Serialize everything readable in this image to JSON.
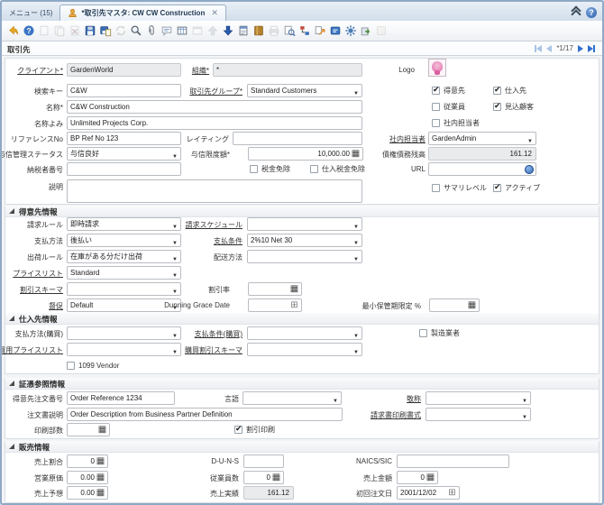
{
  "tabs": {
    "menu": "メニュー (15)",
    "window": "*取引先マスタ: CW CW Construction"
  },
  "window": {
    "title": "取引先",
    "record_position": "*1/17"
  },
  "toolbar": {
    "icons": [
      {
        "name": "undo-icon",
        "enabled": true
      },
      {
        "name": "help-icon",
        "enabled": true
      },
      {
        "name": "new-record-icon",
        "enabled": false
      },
      {
        "name": "copy-record-icon",
        "enabled": false
      },
      {
        "name": "delete-record-icon",
        "enabled": false
      },
      {
        "name": "save-icon",
        "enabled": true
      },
      {
        "name": "save-create-icon",
        "enabled": true
      },
      {
        "name": "refresh-icon",
        "enabled": false
      },
      {
        "name": "find-icon",
        "enabled": true
      },
      {
        "name": "attachment-icon",
        "enabled": true
      },
      {
        "name": "chat-icon",
        "enabled": true
      },
      {
        "name": "grid-toggle-icon",
        "enabled": true
      },
      {
        "name": "preference-icon",
        "enabled": false
      },
      {
        "name": "parent-record-icon",
        "enabled": false
      },
      {
        "name": "detail-record-icon",
        "enabled": true
      },
      {
        "name": "report-icon",
        "enabled": true
      },
      {
        "name": "archive-icon",
        "enabled": true
      },
      {
        "name": "print-icon",
        "enabled": false
      },
      {
        "name": "record-info-icon",
        "enabled": true
      },
      {
        "name": "workflow-icon",
        "enabled": true
      },
      {
        "name": "zoom-across-icon",
        "enabled": true
      },
      {
        "name": "request-icon",
        "enabled": true
      },
      {
        "name": "process-icon",
        "enabled": true
      },
      {
        "name": "export-icon",
        "enabled": true
      },
      {
        "name": "post-icon",
        "enabled": false
      }
    ]
  },
  "sections": {
    "customer": "得意先情報",
    "vendor": "仕入先情報",
    "docref": "証憑参照情報",
    "sales": "販売情報"
  },
  "fields": {
    "client": {
      "label": "クライアント*",
      "value": "GardenWorld"
    },
    "org": {
      "label": "組織*",
      "value": "*"
    },
    "logo": {
      "label": "Logo"
    },
    "search_key": {
      "label": "検索キー",
      "value": "C&W"
    },
    "bp_group": {
      "label": "取引先グループ*",
      "value": "Standard Customers"
    },
    "customer_chk": {
      "label": "得意先",
      "checked": true
    },
    "vendor_chk": {
      "label": "仕入先",
      "checked": true
    },
    "name": {
      "label": "名称*",
      "value": "C&W Construction"
    },
    "employee_chk": {
      "label": "従業員",
      "checked": false
    },
    "prospect_chk": {
      "label": "見込顧客",
      "checked": true
    },
    "name2": {
      "label": "名称よみ",
      "value": "Unlimited Projects Corp."
    },
    "salesrep_chk": {
      "label": "社内担当者",
      "checked": false
    },
    "reference_no": {
      "label": "リファレンスNo",
      "value": "BP Ref No 123"
    },
    "rating": {
      "label": "レイティング",
      "value": ""
    },
    "sales_rep": {
      "label": "社内担当者",
      "value": "GardenAdmin"
    },
    "credit_status": {
      "label": "与信管理ステータス",
      "value": "与信良好"
    },
    "credit_limit": {
      "label": "与信限度額*",
      "value": "10,000.00"
    },
    "open_balance": {
      "label": "債権債務残高",
      "value": "161.12"
    },
    "tax_id": {
      "label": "納税者番号",
      "value": ""
    },
    "tax_exempt_chk": {
      "label": "税金免除",
      "checked": false
    },
    "po_tax_exempt_chk": {
      "label": "仕入税金免除",
      "checked": false
    },
    "url": {
      "label": "URL",
      "value": ""
    },
    "description": {
      "label": "説明",
      "value": ""
    },
    "summary_chk": {
      "label": "サマリレベル",
      "checked": false
    },
    "active_chk": {
      "label": "アクティブ",
      "checked": true
    },
    "invoice_rule": {
      "label": "請求ルール",
      "value": "即時請求"
    },
    "invoice_schedule": {
      "label": "請求スケジュール",
      "value": ""
    },
    "payment_rule": {
      "label": "支払方法",
      "value": "後払い"
    },
    "payment_term": {
      "label": "支払条件",
      "value": "2%10 Net 30"
    },
    "delivery_rule": {
      "label": "出荷ルール",
      "value": "在庫がある分だけ出荷"
    },
    "delivery_via": {
      "label": "配送方法",
      "value": ""
    },
    "price_list": {
      "label": "プライスリスト",
      "value": "Standard"
    },
    "discount_schema": {
      "label": "割引スキーマ",
      "value": ""
    },
    "flat_discount": {
      "label": "割引率",
      "value": ""
    },
    "dunning": {
      "label": "督促",
      "value": "Default"
    },
    "dunning_grace": {
      "label": "Dunning Grace Date",
      "value": ""
    },
    "min_shelf_life": {
      "label": "最小保管期限定 %",
      "value": ""
    },
    "po_payment_rule": {
      "label": "支払方法(購買)",
      "value": ""
    },
    "po_payment_term": {
      "label": "支払条件(購買)",
      "value": ""
    },
    "manufacturer_chk": {
      "label": "製造業者",
      "checked": false
    },
    "po_price_list": {
      "label": "購買用プライスリスト",
      "value": ""
    },
    "po_discount_schema": {
      "label": "購買割引スキーマ",
      "value": ""
    },
    "vendor_1099_chk": {
      "label": "1099 Vendor",
      "checked": false
    },
    "po_reference": {
      "label": "得意先注文番号",
      "value": "Order Reference 1234"
    },
    "language": {
      "label": "言語",
      "value": ""
    },
    "greeting": {
      "label": "敬称",
      "value": ""
    },
    "order_description": {
      "label": "注文書説明",
      "value": "Order Description from Business Partner Definition"
    },
    "invoice_print_format": {
      "label": "請求書印刷書式",
      "value": ""
    },
    "document_copies": {
      "label": "印刷部数",
      "value": ""
    },
    "discount_printed_chk": {
      "label": "割引印刷",
      "checked": true
    },
    "share": {
      "label": "売上割合",
      "value": "0"
    },
    "duns": {
      "label": "D-U-N-S",
      "value": ""
    },
    "naics": {
      "label": "NAICS/SIC",
      "value": ""
    },
    "acquisition_cost": {
      "label": "営業原価",
      "value": "0.00"
    },
    "employees": {
      "label": "従業員数",
      "value": "0"
    },
    "sales_volume": {
      "label": "売上金額",
      "value": "0"
    },
    "potential_value": {
      "label": "売上予想",
      "value": "0.00"
    },
    "actual_value": {
      "label": "売上実績",
      "value": "161.12"
    },
    "first_sale": {
      "label": "初回注文日",
      "value": "2001/12/02"
    }
  },
  "colors": {
    "accent": "#2f6fd0",
    "toolbar_border": "#c9d0d8",
    "window_border": "#8fa9c6",
    "readonly_bg": "#e9ebed"
  }
}
